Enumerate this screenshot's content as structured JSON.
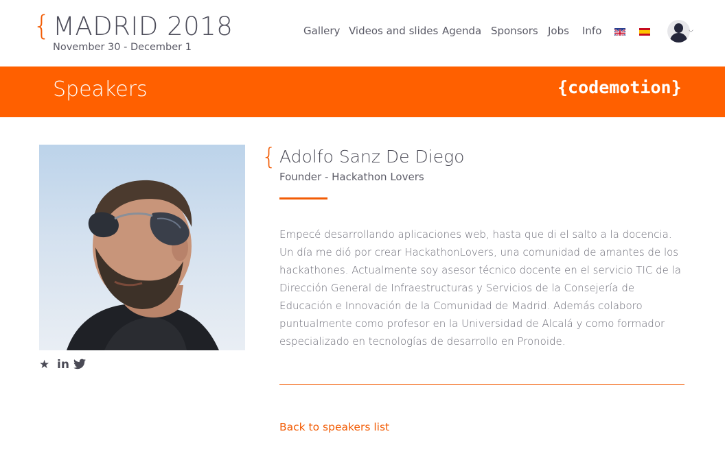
{
  "header": {
    "event_title": "MADRID 2018",
    "event_dates": "November 30 - December 1",
    "nav": [
      {
        "label": "Gallery"
      },
      {
        "label": "Videos and slides"
      },
      {
        "label": "Agenda"
      },
      {
        "label": "Sponsors"
      },
      {
        "label": "Jobs"
      },
      {
        "label": "Info"
      }
    ],
    "languages": [
      "english-flag-icon",
      "spanish-flag-icon"
    ]
  },
  "banner": {
    "title": "Speakers",
    "brand": "{codemotion}"
  },
  "speaker": {
    "name": "Adolfo Sanz De Diego",
    "role": "Founder - Hackathon Lovers",
    "bio": "Empecé desarrollando aplicaciones web, hasta que di el salto a la docencia. Un día me dió por crear HackathonLovers, una comunidad de amantes de los hackathones. Actualmente soy asesor técnico docente en el servicio TIC de la Dirección General de Infraestructuras y Servicios de la Consejería de Educación e Innovación de la Comunidad de Madrid. Además colaboro puntualmente como profesor en la Universidad de Alcalá y como formador especializado en tecnologías de desarrollo en Pronoide.",
    "social_icons": [
      "star-icon",
      "linkedin-icon",
      "twitter-icon"
    ]
  },
  "footer": {
    "back_link": "Back to speakers list"
  },
  "colors": {
    "accent": "#f25c05",
    "banner": "#ff6000",
    "text": "#4a4a55"
  }
}
